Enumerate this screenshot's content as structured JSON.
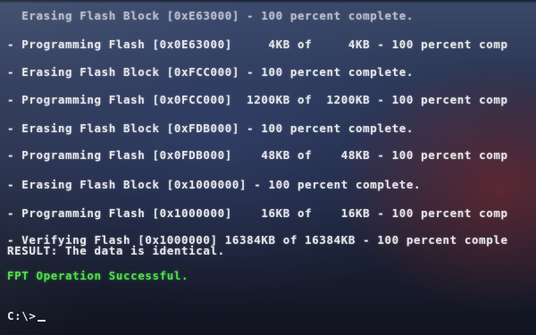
{
  "terminal": {
    "lines": [
      {
        "text": "  Erasing Flash Block [0xE63000] - 100 percent complete."
      },
      {
        "text": "- Programming Flash [0x0E63000]     4KB of     4KB - 100 percent comp"
      },
      {
        "text": "- Erasing Flash Block [0xFCC000] - 100 percent complete."
      },
      {
        "text": "- Programming Flash [0x0FCC000]  1200KB of  1200KB - 100 percent comp"
      },
      {
        "text": "- Erasing Flash Block [0xFDB000] - 100 percent complete."
      },
      {
        "text": "- Programming Flash [0x0FDB000]    48KB of    48KB - 100 percent comp"
      },
      {
        "text": "- Erasing Flash Block [0x1000000] - 100 percent complete."
      },
      {
        "text": "- Programming Flash [0x1000000]    16KB of    16KB - 100 percent comp"
      },
      {
        "text": "- Verifying Flash [0x1000000] 16384KB of 16384KB - 100 percent comple"
      },
      {
        "text": "RESULT: The data is identical."
      }
    ],
    "success_message": "FPT Operation Successful.",
    "prompt": "C:\\>"
  },
  "colors": {
    "text": "#e6e6ea",
    "success": "#4fe04a",
    "background": "#1f2740"
  }
}
